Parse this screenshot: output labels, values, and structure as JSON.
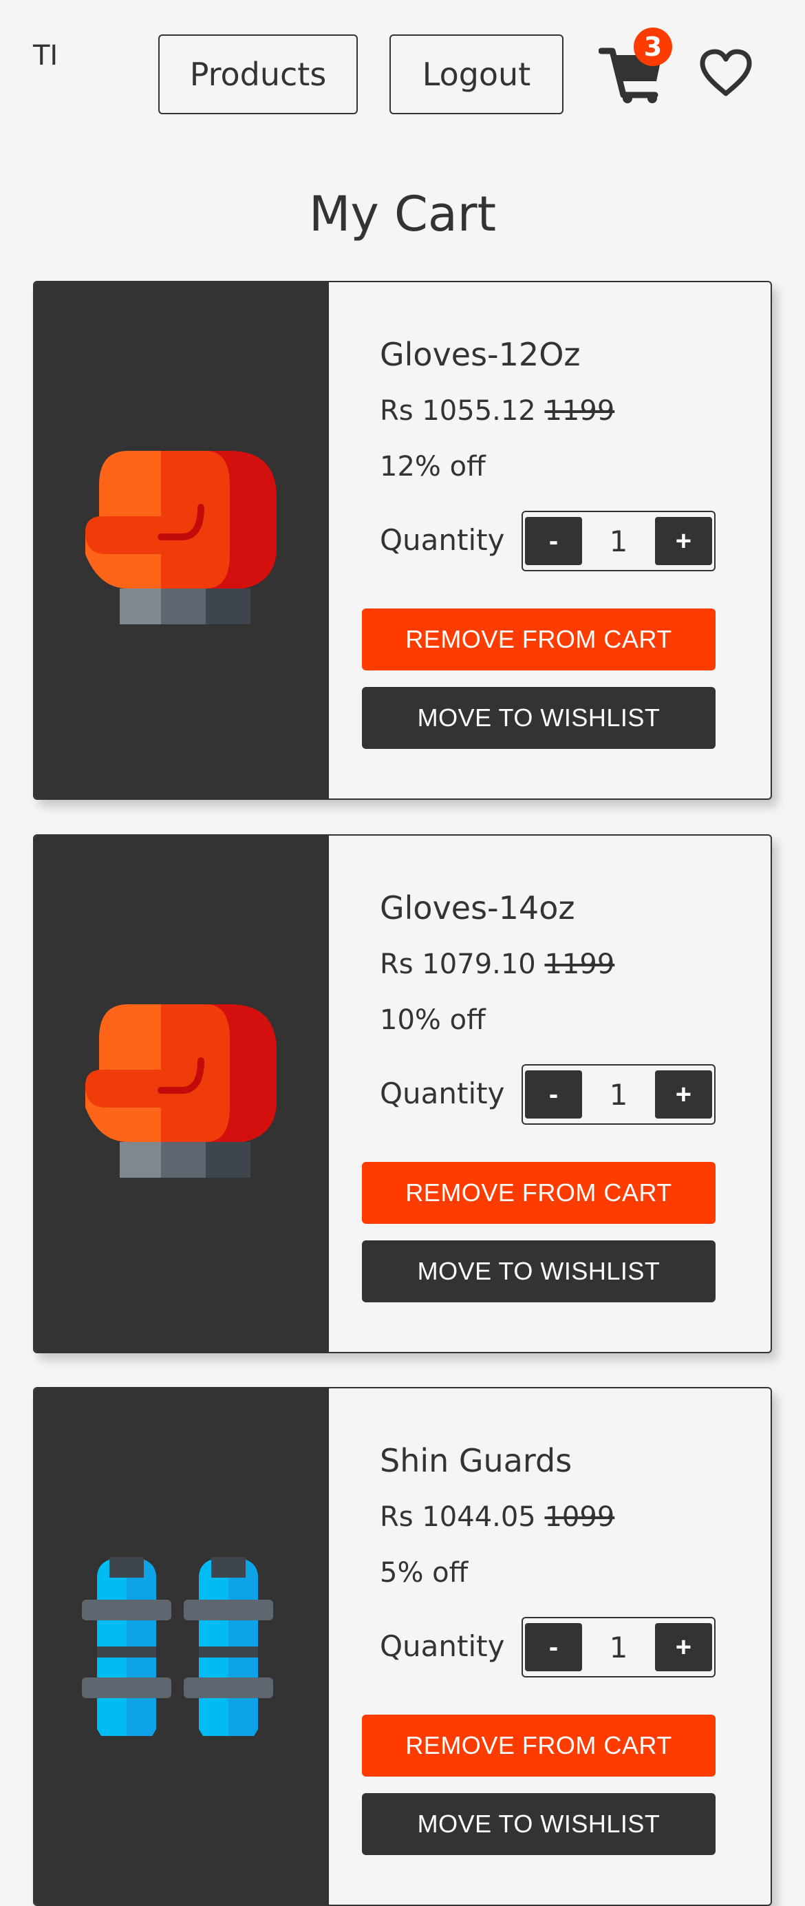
{
  "header": {
    "logo": "TI",
    "products_label": "Products",
    "logout_label": "Logout",
    "cart_count": "3",
    "cart_icon": "cart-icon",
    "wishlist_icon": "heart-icon",
    "accent_color": "#ff3c00"
  },
  "page": {
    "title": "My Cart"
  },
  "items": [
    {
      "name": "Gloves-12Oz",
      "price": "Rs 1055.12",
      "original_price": "1199",
      "discount": "12% off",
      "quantity_label": "Quantity",
      "quantity": "1",
      "decrement": "-",
      "increment": "+",
      "remove_label": "REMOVE FROM CART",
      "wishlist_label": "MOVE TO WISHLIST",
      "image": "boxing-glove-icon"
    },
    {
      "name": "Gloves-14oz",
      "price": "Rs 1079.10",
      "original_price": "1199",
      "discount": "10% off",
      "quantity_label": "Quantity",
      "quantity": "1",
      "decrement": "-",
      "increment": "+",
      "remove_label": "REMOVE FROM CART",
      "wishlist_label": "MOVE TO WISHLIST",
      "image": "boxing-glove-icon"
    },
    {
      "name": "Shin Guards",
      "price": "Rs 1044.05",
      "original_price": "1099",
      "discount": "5% off",
      "quantity_label": "Quantity",
      "quantity": "1",
      "decrement": "-",
      "increment": "+",
      "remove_label": "REMOVE FROM CART",
      "wishlist_label": "MOVE TO WISHLIST",
      "image": "shin-guards-icon"
    }
  ]
}
